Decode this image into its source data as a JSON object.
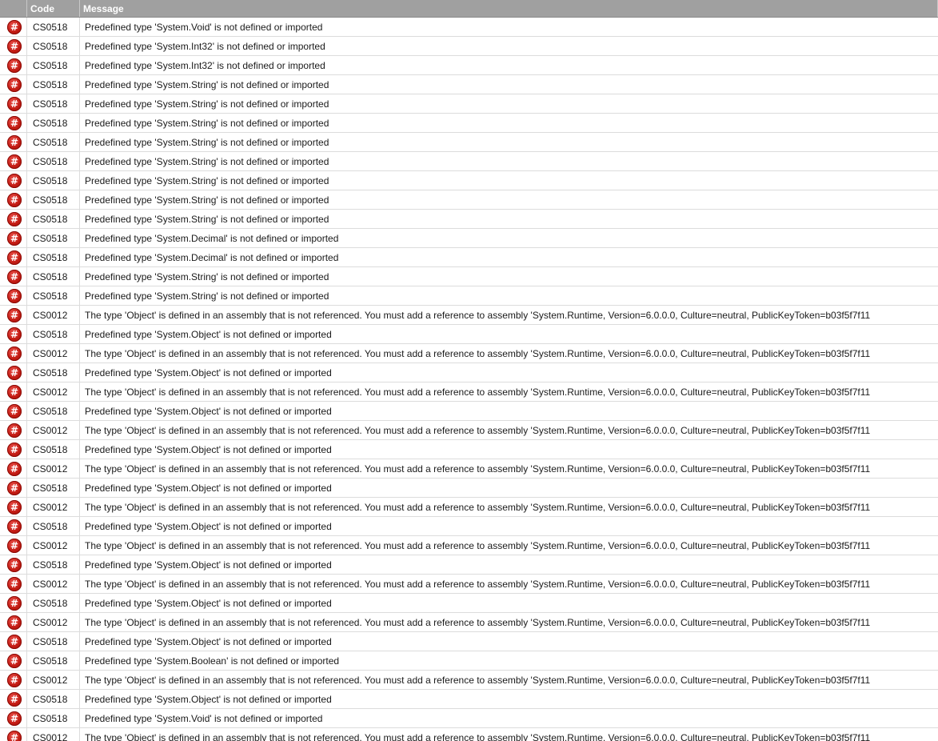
{
  "header": {
    "code_label": "Code",
    "message_label": "Message"
  },
  "icons": {
    "error": "error-icon",
    "glyph": "#",
    "color": "#c41c14"
  },
  "errors": [
    {
      "code": "CS0518",
      "message": "Predefined type 'System.Void' is not defined or imported"
    },
    {
      "code": "CS0518",
      "message": "Predefined type 'System.Int32' is not defined or imported"
    },
    {
      "code": "CS0518",
      "message": "Predefined type 'System.Int32' is not defined or imported"
    },
    {
      "code": "CS0518",
      "message": "Predefined type 'System.String' is not defined or imported"
    },
    {
      "code": "CS0518",
      "message": "Predefined type 'System.String' is not defined or imported"
    },
    {
      "code": "CS0518",
      "message": "Predefined type 'System.String' is not defined or imported"
    },
    {
      "code": "CS0518",
      "message": "Predefined type 'System.String' is not defined or imported"
    },
    {
      "code": "CS0518",
      "message": "Predefined type 'System.String' is not defined or imported"
    },
    {
      "code": "CS0518",
      "message": "Predefined type 'System.String' is not defined or imported"
    },
    {
      "code": "CS0518",
      "message": "Predefined type 'System.String' is not defined or imported"
    },
    {
      "code": "CS0518",
      "message": "Predefined type 'System.String' is not defined or imported"
    },
    {
      "code": "CS0518",
      "message": "Predefined type 'System.Decimal' is not defined or imported"
    },
    {
      "code": "CS0518",
      "message": "Predefined type 'System.Decimal' is not defined or imported"
    },
    {
      "code": "CS0518",
      "message": "Predefined type 'System.String' is not defined or imported"
    },
    {
      "code": "CS0518",
      "message": "Predefined type 'System.String' is not defined or imported"
    },
    {
      "code": "CS0012",
      "message": "The type 'Object' is defined in an assembly that is not referenced. You must add a reference to assembly 'System.Runtime, Version=6.0.0.0, Culture=neutral, PublicKeyToken=b03f5f7f11"
    },
    {
      "code": "CS0518",
      "message": "Predefined type 'System.Object' is not defined or imported"
    },
    {
      "code": "CS0012",
      "message": "The type 'Object' is defined in an assembly that is not referenced. You must add a reference to assembly 'System.Runtime, Version=6.0.0.0, Culture=neutral, PublicKeyToken=b03f5f7f11"
    },
    {
      "code": "CS0518",
      "message": "Predefined type 'System.Object' is not defined or imported"
    },
    {
      "code": "CS0012",
      "message": "The type 'Object' is defined in an assembly that is not referenced. You must add a reference to assembly 'System.Runtime, Version=6.0.0.0, Culture=neutral, PublicKeyToken=b03f5f7f11"
    },
    {
      "code": "CS0518",
      "message": "Predefined type 'System.Object' is not defined or imported"
    },
    {
      "code": "CS0012",
      "message": "The type 'Object' is defined in an assembly that is not referenced. You must add a reference to assembly 'System.Runtime, Version=6.0.0.0, Culture=neutral, PublicKeyToken=b03f5f7f11"
    },
    {
      "code": "CS0518",
      "message": "Predefined type 'System.Object' is not defined or imported"
    },
    {
      "code": "CS0012",
      "message": "The type 'Object' is defined in an assembly that is not referenced. You must add a reference to assembly 'System.Runtime, Version=6.0.0.0, Culture=neutral, PublicKeyToken=b03f5f7f11"
    },
    {
      "code": "CS0518",
      "message": "Predefined type 'System.Object' is not defined or imported"
    },
    {
      "code": "CS0012",
      "message": "The type 'Object' is defined in an assembly that is not referenced. You must add a reference to assembly 'System.Runtime, Version=6.0.0.0, Culture=neutral, PublicKeyToken=b03f5f7f11"
    },
    {
      "code": "CS0518",
      "message": "Predefined type 'System.Object' is not defined or imported"
    },
    {
      "code": "CS0012",
      "message": "The type 'Object' is defined in an assembly that is not referenced. You must add a reference to assembly 'System.Runtime, Version=6.0.0.0, Culture=neutral, PublicKeyToken=b03f5f7f11"
    },
    {
      "code": "CS0518",
      "message": "Predefined type 'System.Object' is not defined or imported"
    },
    {
      "code": "CS0012",
      "message": "The type 'Object' is defined in an assembly that is not referenced. You must add a reference to assembly 'System.Runtime, Version=6.0.0.0, Culture=neutral, PublicKeyToken=b03f5f7f11"
    },
    {
      "code": "CS0518",
      "message": "Predefined type 'System.Object' is not defined or imported"
    },
    {
      "code": "CS0012",
      "message": "The type 'Object' is defined in an assembly that is not referenced. You must add a reference to assembly 'System.Runtime, Version=6.0.0.0, Culture=neutral, PublicKeyToken=b03f5f7f11"
    },
    {
      "code": "CS0518",
      "message": "Predefined type 'System.Object' is not defined or imported"
    },
    {
      "code": "CS0518",
      "message": "Predefined type 'System.Boolean' is not defined or imported"
    },
    {
      "code": "CS0012",
      "message": "The type 'Object' is defined in an assembly that is not referenced. You must add a reference to assembly 'System.Runtime, Version=6.0.0.0, Culture=neutral, PublicKeyToken=b03f5f7f11"
    },
    {
      "code": "CS0518",
      "message": "Predefined type 'System.Object' is not defined or imported"
    },
    {
      "code": "CS0518",
      "message": "Predefined type 'System.Void' is not defined or imported"
    },
    {
      "code": "CS0012",
      "message": "The type 'Object' is defined in an assembly that is not referenced. You must add a reference to assembly 'System.Runtime, Version=6.0.0.0, Culture=neutral, PublicKeyToken=b03f5f7f11"
    }
  ]
}
